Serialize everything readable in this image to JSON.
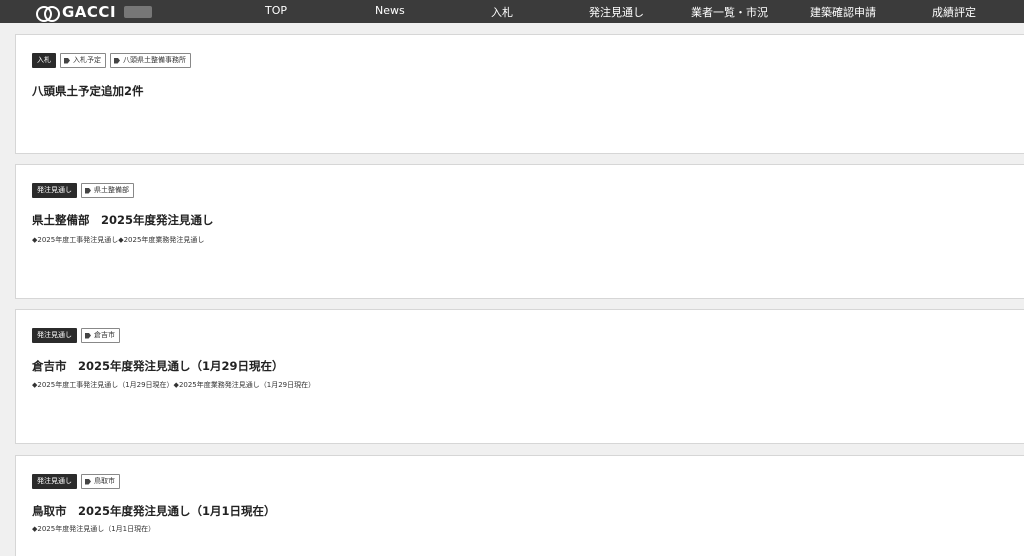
{
  "header": {
    "logo_text": "GACCI",
    "nav": [
      "TOP",
      "News",
      "入札",
      "発注見通し",
      "業者一覧・市況",
      "建築確認申請",
      "成績評定"
    ]
  },
  "posts": [
    {
      "category": "入札",
      "tags": [
        "入札予定",
        "八頭県土整備事務所"
      ],
      "title": "八頭県土予定追加2件",
      "excerpt": ""
    },
    {
      "category": "発注見通し",
      "tags": [
        "県土整備部"
      ],
      "title": "県土整備部　2025年度発注見通し",
      "excerpt": "◆2025年度工事発注見通し◆2025年度業務発注見通し"
    },
    {
      "category": "発注見通し",
      "tags": [
        "倉吉市"
      ],
      "title": "倉吉市　2025年度発注見通し（1月29日現在）",
      "excerpt": "◆2025年度工事発注見通し（1月29日現在）◆2025年度業務発注見通し（1月29日現在）"
    },
    {
      "category": "発注見通し",
      "tags": [
        "鳥取市"
      ],
      "title": "鳥取市　2025年度発注見通し（1月1日現在）",
      "excerpt": "◆2025年度発注見通し（1月1日現在）"
    }
  ]
}
